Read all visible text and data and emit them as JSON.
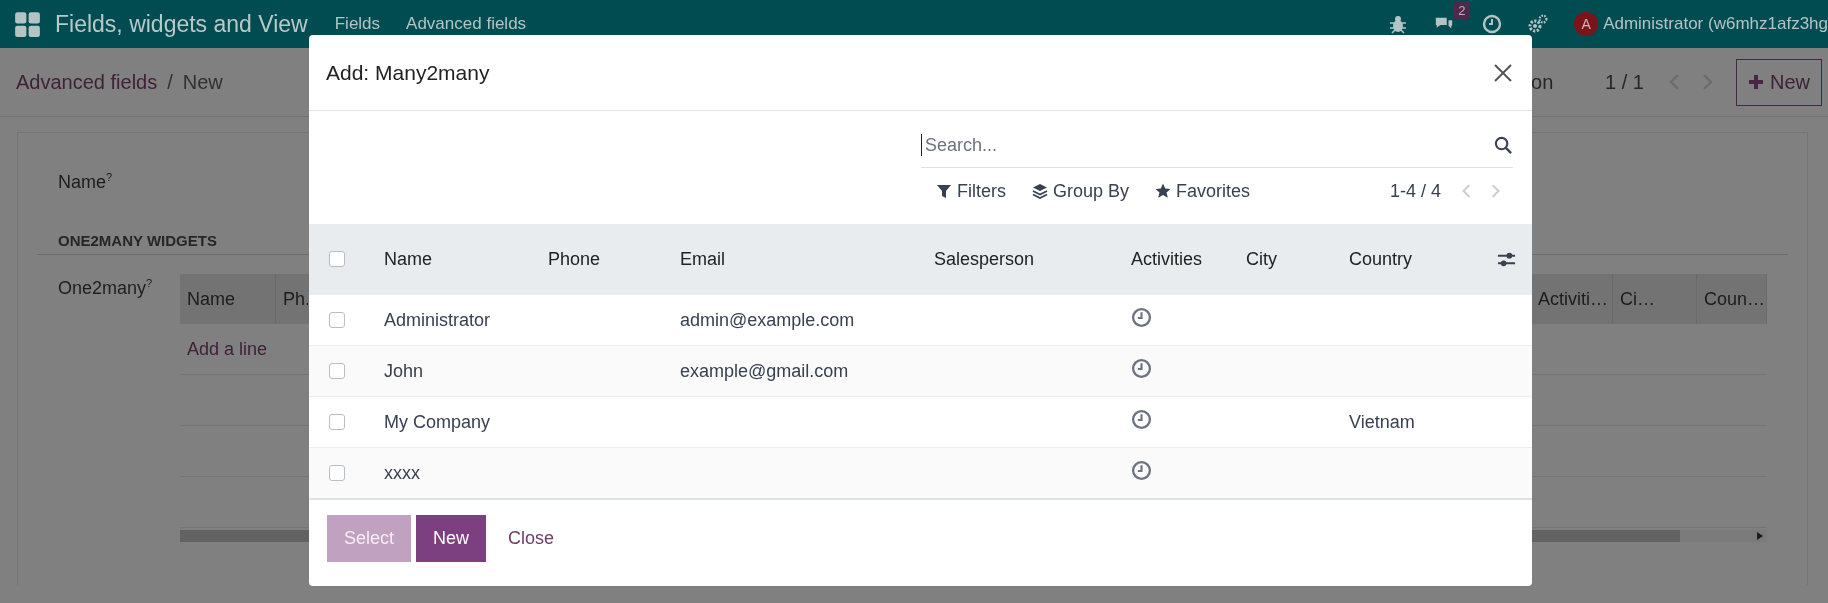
{
  "navbar": {
    "app_title": "Fields, widgets and View",
    "menu": [
      "Fields",
      "Advanced fields"
    ],
    "messages_badge": "2",
    "avatar_initial": "A",
    "user": "Administrator (w6mhz1afz3hg"
  },
  "control_panel": {
    "breadcrumb": [
      "Advanced fields",
      "New"
    ],
    "separator": "/",
    "action_fragment": "on",
    "pager": "1 / 1",
    "new_button": "New"
  },
  "form": {
    "name_label": "Name$^{?}$",
    "section_title": "ONE2MANY WIDGETS",
    "one2many_label": "One2many$^{?}$",
    "one2many_list": {
      "columns_left": [
        "Name",
        "Ph."
      ],
      "columns_right": [
        "Activiti…",
        "Ci…",
        "Coun…"
      ],
      "add_line": "Add a line"
    }
  },
  "dialog": {
    "title": "Add: Many2many",
    "search": {
      "placeholder": "Search..."
    },
    "filters": [
      {
        "label": "Filters",
        "kind": "filter"
      },
      {
        "label": "Group By",
        "kind": "group"
      },
      {
        "label": "Favorites",
        "kind": "favorite"
      }
    ],
    "pager": "1-4 / 4",
    "table": {
      "all_selected": false,
      "columns": [
        "Name",
        "Phone",
        "Email",
        "Salesperson",
        "Activities",
        "City",
        "Country"
      ],
      "rows": [
        {
          "selected": false,
          "name": "Administrator",
          "email": "admin@example.com"
        },
        {
          "selected": false,
          "name": "John",
          "email": "example@gmail.com"
        },
        {
          "selected": false,
          "name": "My Company",
          "country": "Vietnam"
        },
        {
          "selected": false,
          "name": "xxxx"
        }
      ]
    },
    "buttons": [
      {
        "label": "Select",
        "kind": "primary",
        "disabled": true
      },
      {
        "label": "New",
        "kind": "primary",
        "disabled": false
      },
      {
        "label": "Close",
        "kind": "link",
        "disabled": false
      }
    ]
  }
}
